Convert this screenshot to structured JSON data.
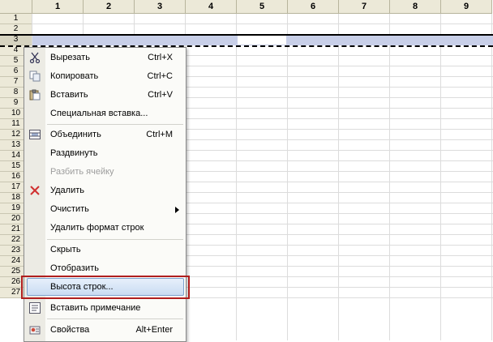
{
  "columns": [
    "1",
    "2",
    "3",
    "4",
    "5",
    "6",
    "7",
    "8",
    "9"
  ],
  "rows": [
    "1",
    "2",
    "3",
    "4",
    "5",
    "6",
    "7",
    "8",
    "9",
    "10",
    "11",
    "12",
    "13",
    "14",
    "15",
    "16",
    "17",
    "18",
    "19",
    "20",
    "21",
    "22",
    "23",
    "24",
    "25",
    "26",
    "27"
  ],
  "menu": {
    "items": [
      {
        "label": "Вырезать",
        "shortcut": "Ctrl+X",
        "icon": "scissors-icon"
      },
      {
        "label": "Копировать",
        "shortcut": "Ctrl+C",
        "icon": "copy-icon"
      },
      {
        "label": "Вставить",
        "shortcut": "Ctrl+V",
        "icon": "paste-icon"
      },
      {
        "label": "Специальная вставка...",
        "shortcut": ""
      },
      {
        "label": "Объединить",
        "shortcut": "Ctrl+M",
        "icon": "merge-cells-icon"
      },
      {
        "label": "Раздвинуть",
        "shortcut": ""
      },
      {
        "label": "Разбить ячейку",
        "shortcut": "",
        "disabled": true
      },
      {
        "label": "Удалить",
        "shortcut": "",
        "icon": "delete-x-icon"
      },
      {
        "label": "Очистить",
        "shortcut": "",
        "submenu": true
      },
      {
        "label": "Удалить формат строк",
        "shortcut": ""
      },
      {
        "label": "Скрыть",
        "shortcut": ""
      },
      {
        "label": "Отобразить",
        "shortcut": ""
      },
      {
        "label": "Высота строк...",
        "shortcut": "",
        "highlighted": true
      },
      {
        "label": "Вставить примечание",
        "shortcut": "",
        "icon": "note-icon"
      },
      {
        "label": "Свойства",
        "shortcut": "Alt+Enter",
        "icon": "properties-icon"
      }
    ]
  },
  "colors": {
    "accent": "#c8cfe8",
    "highlight_border": "#b01e1e",
    "delete_icon": "#d03030"
  }
}
